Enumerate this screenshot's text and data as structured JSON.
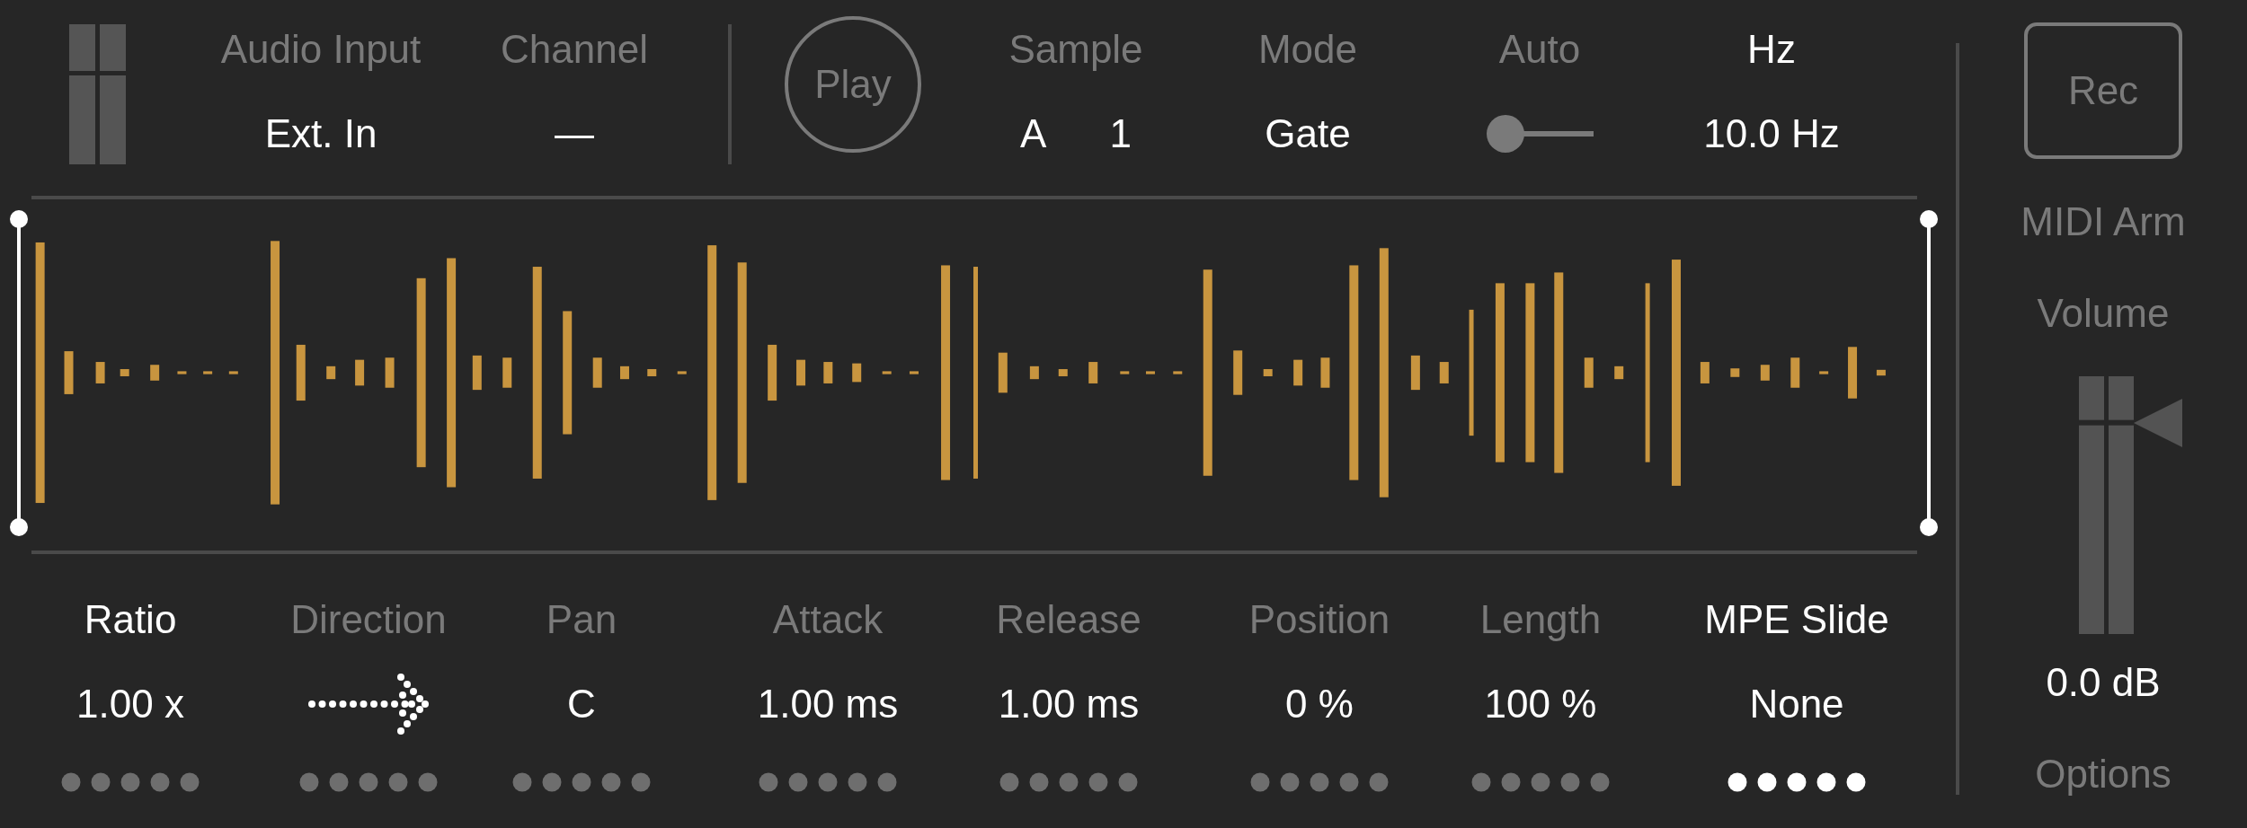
{
  "top_controls": [
    {
      "kind": "value",
      "label": "Audio Input",
      "active": false,
      "value": "Ext. In"
    },
    {
      "kind": "value",
      "label": "Channel",
      "active": false,
      "value": "—"
    },
    {
      "kind": "play",
      "label": "Play"
    },
    {
      "kind": "sample",
      "label": "Sample",
      "active": false,
      "values": [
        "A",
        "1"
      ]
    },
    {
      "kind": "value",
      "label": "Mode",
      "active": false,
      "value": "Gate"
    },
    {
      "kind": "toggle",
      "label": "Auto",
      "active": false,
      "on": false
    },
    {
      "kind": "value",
      "label": "Hz",
      "active": true,
      "value": "10.0 Hz"
    }
  ],
  "params": [
    {
      "kind": "value",
      "label": "Ratio",
      "active": true,
      "value": "1.00 x",
      "selected": false
    },
    {
      "kind": "arrow",
      "label": "Direction",
      "active": false,
      "selected": false
    },
    {
      "kind": "value",
      "label": "Pan",
      "active": false,
      "value": "C",
      "selected": false
    },
    {
      "kind": "value",
      "label": "Attack",
      "active": false,
      "value": "1.00 ms",
      "selected": false
    },
    {
      "kind": "value",
      "label": "Release",
      "active": false,
      "value": "1.00 ms",
      "selected": false
    },
    {
      "kind": "value",
      "label": "Position",
      "active": false,
      "value": "0 %",
      "selected": false
    },
    {
      "kind": "value",
      "label": "Length",
      "active": false,
      "value": "100 %",
      "selected": false
    },
    {
      "kind": "value",
      "label": "MPE Slide",
      "active": true,
      "value": "None",
      "selected": true
    }
  ],
  "side": {
    "rec_button": "Rec",
    "midi_arm": "MIDI Arm",
    "volume_label": "Volume",
    "volume": {
      "level": 0.82,
      "reading": "0.0 dB"
    },
    "options": "Options"
  }
}
